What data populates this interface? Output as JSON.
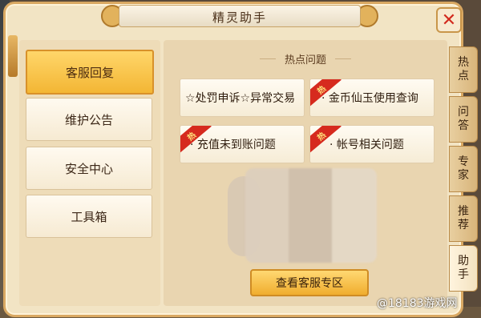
{
  "window": {
    "title": "精灵助手",
    "close_icon": "close-icon"
  },
  "left_menu": [
    {
      "label": "客服回复",
      "active": true
    },
    {
      "label": "维护公告",
      "active": false
    },
    {
      "label": "安全中心",
      "active": false
    },
    {
      "label": "工具箱",
      "active": false
    }
  ],
  "hot_section": {
    "title": "热点问题",
    "badge": "热",
    "questions": [
      {
        "label": "☆处罚申诉☆异常交易",
        "hot": false
      },
      {
        "label": "· 金币仙玉使用查询",
        "hot": true
      },
      {
        "label": "· 充值未到账问题",
        "hot": true
      },
      {
        "label": "· 帐号相关问题",
        "hot": true
      }
    ]
  },
  "cta": {
    "label": "查看客服专区"
  },
  "side_tabs": [
    {
      "line1": "热",
      "line2": "点",
      "active": false
    },
    {
      "line1": "问",
      "line2": "答",
      "active": false
    },
    {
      "line1": "专",
      "line2": "家",
      "active": false
    },
    {
      "line1": "推",
      "line2": "荐",
      "active": false
    },
    {
      "line1": "助",
      "line2": "手",
      "active": true
    }
  ],
  "watermark": "@18183游戏网",
  "colors": {
    "accent": "#f3b634",
    "hot_red": "#d62a1e",
    "panel": "#f2e4c4"
  }
}
